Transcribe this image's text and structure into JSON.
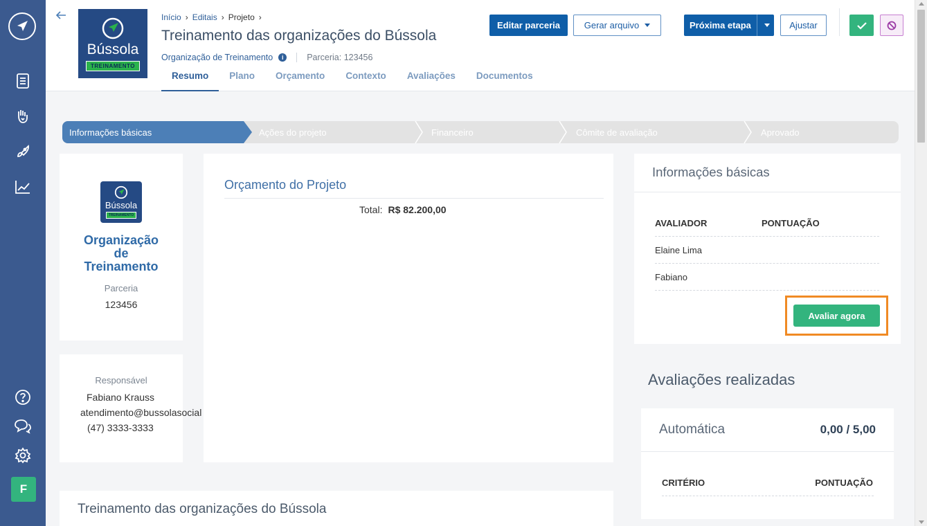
{
  "sidebar": {
    "avatar_letter": "F",
    "icons": [
      "compass-logo-icon",
      "document-icon",
      "hand-heart-icon",
      "rocket-icon",
      "chart-icon",
      "help-icon",
      "chat-icon",
      "gear-icon"
    ]
  },
  "header": {
    "breadcrumb": [
      "Início",
      "Editais",
      "Projeto"
    ],
    "title": "Treinamento das organizações do Bússola",
    "org_link": "Organização de Treinamento",
    "partnership": "Parceria: 123456",
    "logo_word": "Bússola",
    "logo_tag": "TREINAMENTO",
    "tabs": [
      "Resumo",
      "Plano",
      "Orçamento",
      "Contexto",
      "Avaliações",
      "Documentos"
    ],
    "buttons": {
      "edit": "Editar parceria",
      "generate": "Gerar arquivo",
      "next": "Próxima etapa",
      "adjust": "Ajustar"
    }
  },
  "steps": [
    "Informações básicas",
    "Ações do projeto",
    "Financeiro",
    "Cômite de avaliação",
    "Aprovado"
  ],
  "org_card": {
    "logo_word": "Bússola",
    "logo_tag": "TREINAMENTO",
    "name": "Organização de Treinamento",
    "label": "Parceria",
    "number": "123456"
  },
  "responsible": {
    "label": "Responsável",
    "name": "Fabiano Krauss",
    "email": "atendimento@bussolasocial",
    "phone": "(47) 3333-3333"
  },
  "budget": {
    "title": "Orçamento do Projeto",
    "total_label": "Total:",
    "total_value": "R$ 82.200,00"
  },
  "project": {
    "title": "Treinamento das organizações do Bússola"
  },
  "info": {
    "title": "Informações básicas",
    "col_evaluator": "AVALIADOR",
    "col_score": "PONTUAÇÃO",
    "rows": [
      "Elaine Lima",
      "Fabiano"
    ],
    "button": "Avaliar agora"
  },
  "evaluations": {
    "heading": "Avaliações realizadas",
    "auto_label": "Automática",
    "auto_score": "0,00 / 5,00",
    "col_criterion": "CRITÉRIO",
    "col_score": "PONTUAÇÃO"
  },
  "colors": {
    "sidebar": "#3b5a8f",
    "primary": "#0f5ea8",
    "accent_green": "#33b47e",
    "highlight": "#f08a24"
  }
}
